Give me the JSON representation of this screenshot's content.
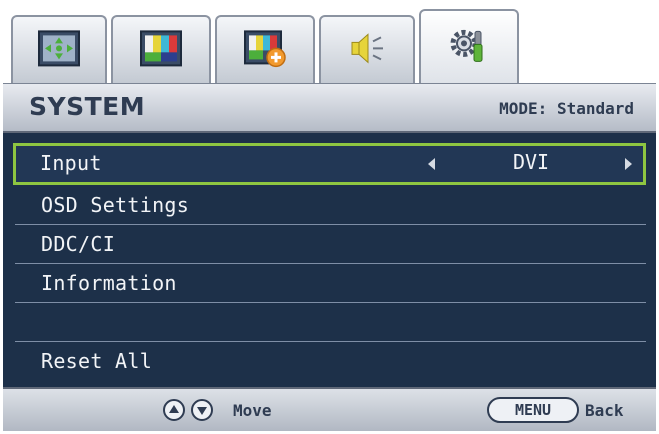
{
  "tabs": [
    {
      "icon": "display-adjust-icon",
      "active": false
    },
    {
      "icon": "picture-icon",
      "active": false
    },
    {
      "icon": "picture-advanced-icon",
      "active": false
    },
    {
      "icon": "audio-icon",
      "active": false
    },
    {
      "icon": "system-settings-icon",
      "active": true
    }
  ],
  "header": {
    "title": "SYSTEM",
    "mode": "MODE: Standard"
  },
  "menu": {
    "items": [
      {
        "label": "Input",
        "value": "DVI",
        "selected": true
      },
      {
        "label": "OSD Settings"
      },
      {
        "label": "DDC/CI"
      },
      {
        "label": "Information"
      },
      {
        "label": ""
      },
      {
        "label": "Reset All"
      }
    ]
  },
  "footer": {
    "move_label": "Move",
    "menu_button": "MENU",
    "back_label": "Back"
  },
  "colors": {
    "menu_background": "#1d3049",
    "selection_border": "#8ec641",
    "header_text": "#2f3c52"
  }
}
